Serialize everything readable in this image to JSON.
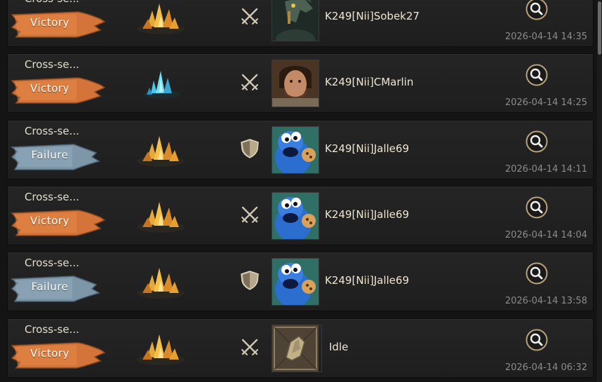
{
  "battle_log": {
    "rows": [
      {
        "mode": "Cross-se...",
        "result": "Victory",
        "resource": "gold",
        "type": "attack",
        "avatar": "sobek",
        "player": "K249[Nii]Sobek27",
        "time": "2026-04-14 14:35"
      },
      {
        "mode": "Cross-se...",
        "result": "Victory",
        "resource": "crystal",
        "type": "attack",
        "avatar": "man",
        "player": "K249[Nii]CMarlin",
        "time": "2026-04-14 14:25"
      },
      {
        "mode": "Cross-se...",
        "result": "Failure",
        "resource": "gold",
        "type": "defense",
        "avatar": "monster",
        "player": "K249[Nii]Jalle69",
        "time": "2026-04-14 14:11"
      },
      {
        "mode": "Cross-se...",
        "result": "Victory",
        "resource": "gold",
        "type": "attack",
        "avatar": "monster",
        "player": "K249[Nii]Jalle69",
        "time": "2026-04-14 14:04"
      },
      {
        "mode": "Cross-se...",
        "result": "Failure",
        "resource": "gold",
        "type": "defense",
        "avatar": "monster",
        "player": "K249[Nii]Jalle69",
        "time": "2026-04-14 13:58"
      },
      {
        "mode": "Cross-se...",
        "result": "Victory",
        "resource": "gold",
        "type": "attack",
        "avatar": "idle",
        "player": "Idle",
        "time": "2026-04-14 06:32"
      }
    ]
  },
  "colors": {
    "victory_banner": "#d4743a",
    "failure_banner": "#7d96a8",
    "row_bg": "#222222"
  },
  "icons": {
    "resource_gold": "gold-ore-pile-icon",
    "resource_crystal": "blue-crystal-icon",
    "attack": "crossed-swords-icon",
    "defense": "shield-icon",
    "details": "magnifier-icon"
  }
}
